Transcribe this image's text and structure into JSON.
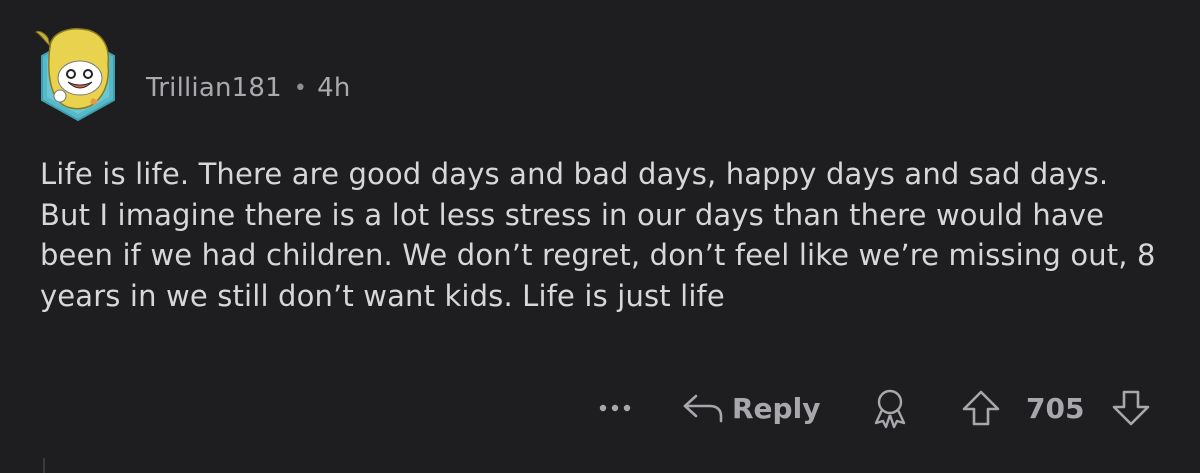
{
  "comment": {
    "username": "Trillian181",
    "separator": "•",
    "age": "4h",
    "body": "Life is life. There are good days and bad days, happy days and sad days. But I imagine there is a lot less stress in our days than there would have been if we had children. We don’t regret, don’t feel like we’re missing out, 8 years in we still don’t want kids. Life is just life"
  },
  "actions": {
    "reply_label": "Reply",
    "score": "705"
  },
  "icons": {
    "avatar": "snoo-avatar",
    "more": "more-dots-icon",
    "reply": "reply-arrow-icon",
    "award": "award-icon",
    "upvote": "upvote-arrow-icon",
    "downvote": "downvote-arrow-icon"
  },
  "colors": {
    "background": "#1e1e20",
    "text": "#d7d7da",
    "muted": "#a7a7ac",
    "avatar_ring": "#4fb3c4",
    "avatar_yellow": "#e8d44d"
  }
}
